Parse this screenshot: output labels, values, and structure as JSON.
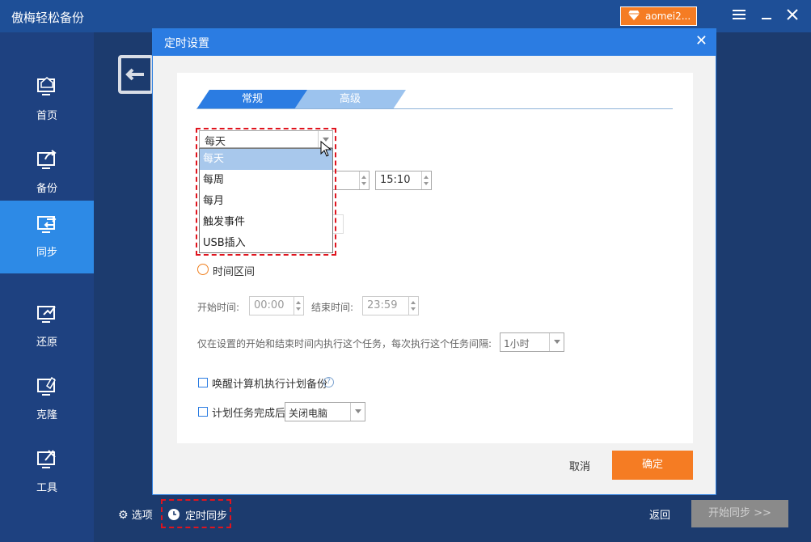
{
  "app": {
    "title": "傲梅轻松备份",
    "account": "aomei2..."
  },
  "titlebar": {
    "menu_icon": "menu-icon",
    "minimize": "minimize-icon",
    "close": "close-icon"
  },
  "sidebar": {
    "items": [
      {
        "label": "首页",
        "icon": "home-icon"
      },
      {
        "label": "备份",
        "icon": "backup-icon"
      },
      {
        "label": "同步",
        "icon": "sync-icon",
        "active": true
      },
      {
        "label": "还原",
        "icon": "restore-icon"
      },
      {
        "label": "克隆",
        "icon": "clone-icon"
      },
      {
        "label": "工具",
        "icon": "tools-icon"
      }
    ]
  },
  "footer": {
    "options": "选项",
    "schedule": "定时同步",
    "back": "返回",
    "start": "开始同步 >>"
  },
  "dialog": {
    "title": "定时设置",
    "tabs": {
      "general": "常规",
      "advanced": "高级"
    },
    "frequency": {
      "value": "每天",
      "options": [
        "每天",
        "每周",
        "每月",
        "触发事件",
        "USB插入"
      ]
    },
    "time_value": "15:10",
    "interval_label": "时间区间",
    "start_time_label": "开始时间:",
    "start_time": "00:00",
    "end_time_label": "结束时间:",
    "end_time": "23:59",
    "repeat_text": "仅在设置的开始和结束时间内执行这个任务，每次执行这个任务间隔:",
    "repeat_value": "1小时",
    "wake_label": "唤醒计算机执行计划备份",
    "after_label": "计划任务完成后",
    "after_value": "关闭电脑",
    "cancel": "取消",
    "ok": "确定"
  },
  "colors": {
    "accent": "#2b7ce2",
    "orange": "#f57c23",
    "highlight": "#e0141e"
  }
}
